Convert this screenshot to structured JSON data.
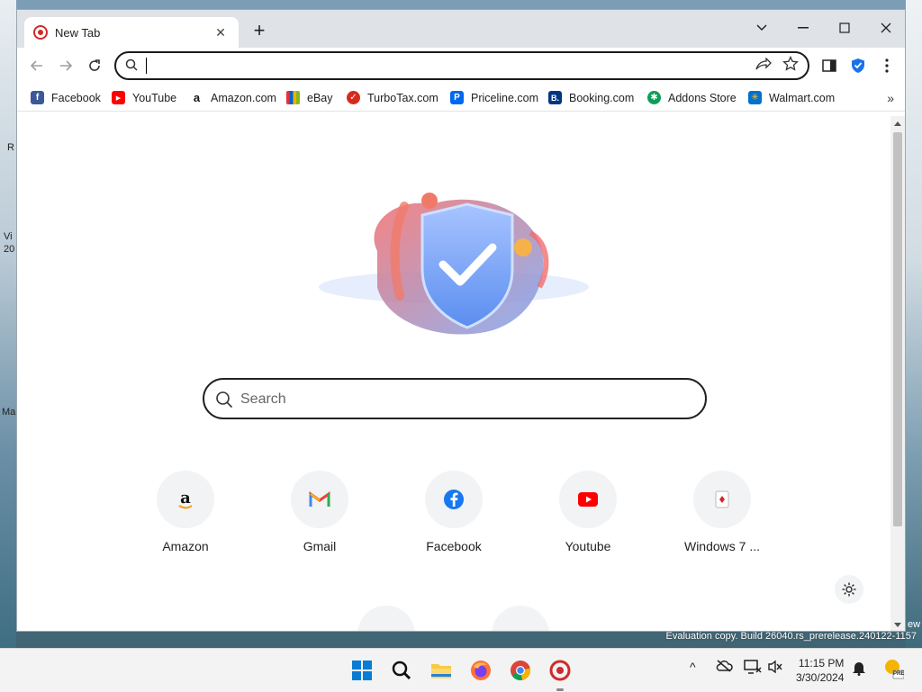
{
  "desktop": {
    "left_labels": [
      "R",
      "Vi",
      "20",
      "Ma"
    ],
    "watermark": "Evaluation copy. Build 26040.rs_prerelease.240122-1157",
    "right_partial": "ew"
  },
  "browser": {
    "tab": {
      "title": "New Tab",
      "close": "✕"
    },
    "newtab": "+",
    "window_controls": {
      "tab_search": "⌄",
      "minimize": "—",
      "maximize": "☐",
      "close": "✕"
    },
    "omnibox": {
      "value": ""
    },
    "bookmarks": [
      {
        "label": "Facebook",
        "icon": "facebook-icon",
        "color": "#3b5998",
        "glyph": "f"
      },
      {
        "label": "YouTube",
        "icon": "youtube-icon",
        "color": "#ff0000",
        "glyph": "▶"
      },
      {
        "label": "Amazon.com",
        "icon": "amazon-icon",
        "color": "#ffffff",
        "glyph": "a"
      },
      {
        "label": "eBay",
        "icon": "ebay-icon",
        "color": "#e53238",
        "glyph": ""
      },
      {
        "label": "TurboTax.com",
        "icon": "turbotax-icon",
        "color": "#d52b1e",
        "glyph": "✓"
      },
      {
        "label": "Priceline.com",
        "icon": "priceline-icon",
        "color": "#0068ef",
        "glyph": "P"
      },
      {
        "label": "Booking.com",
        "icon": "booking-icon",
        "color": "#003580",
        "glyph": "B."
      },
      {
        "label": "Addons Store",
        "icon": "addons-store-icon",
        "color": "#0f9d58",
        "glyph": "✱"
      },
      {
        "label": "Walmart.com",
        "icon": "walmart-icon",
        "color": "#0071ce",
        "glyph": "✳"
      }
    ],
    "bookmarks_more": "»"
  },
  "newtab_page": {
    "search_placeholder": "Search",
    "shortcuts": [
      {
        "label": "Amazon",
        "icon": "amazon-icon"
      },
      {
        "label": "Gmail",
        "icon": "gmail-icon"
      },
      {
        "label": "Facebook",
        "icon": "facebook-icon"
      },
      {
        "label": "Youtube",
        "icon": "youtube-icon"
      },
      {
        "label": "Windows 7 ...",
        "icon": "windows7-game-icon"
      }
    ]
  },
  "taskbar": {
    "apps": [
      "windows-start-icon",
      "search-icon",
      "file-explorer-icon",
      "firefox-icon",
      "chrome-icon",
      "secure-browser-icon"
    ],
    "tray": {
      "chevron": "^"
    },
    "time": "11:15 PM",
    "date": "3/30/2024",
    "pre_badge": "PRE"
  },
  "colors": {
    "accent": "#1a73e8",
    "brand_red": "#d02a2a",
    "shield_blue": "#1a73e8"
  }
}
